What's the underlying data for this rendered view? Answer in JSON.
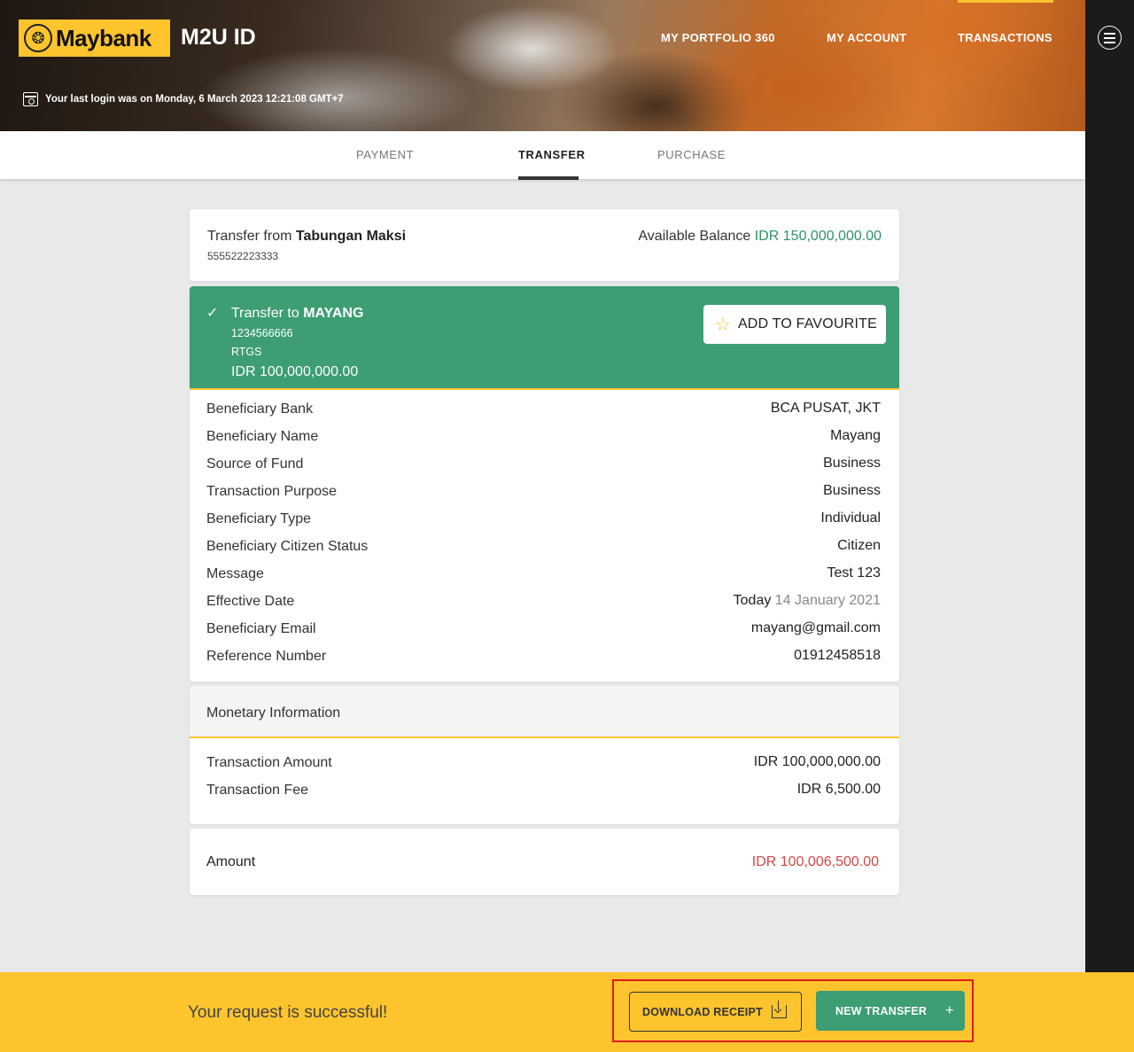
{
  "header": {
    "brand": "Maybank",
    "app_name": "M2U ID",
    "nav": [
      "MY PORTFOLIO 360",
      "MY ACCOUNT",
      "TRANSACTIONS"
    ],
    "last_login": "Your last login was on Monday, 6 March 2023 12:21:08 GMT+7"
  },
  "tabs": [
    "PAYMENT",
    "TRANSFER",
    "PURCHASE"
  ],
  "active_tab": "TRANSFER",
  "transfer_from": {
    "prefix": "Transfer from",
    "account_name": "Tabungan Maksi",
    "account_number": "555522223333",
    "balance_label": "Available Balance",
    "balance_value": "IDR 150,000,000.00"
  },
  "transfer_to": {
    "prefix": "Transfer to",
    "name": "MAYANG",
    "account_number": "1234566666",
    "method": "RTGS",
    "amount": "IDR 100,000,000.00",
    "favourite_label": "ADD TO FAVOURITE"
  },
  "details": [
    {
      "label": "Beneficiary Bank",
      "value": "BCA PUSAT, JKT"
    },
    {
      "label": "Beneficiary Name",
      "value": "Mayang"
    },
    {
      "label": "Source of Fund",
      "value": "Business"
    },
    {
      "label": "Transaction Purpose",
      "value": "Business"
    },
    {
      "label": "Beneficiary Type",
      "value": "Individual"
    },
    {
      "label": "Beneficiary Citizen Status",
      "value": "Citizen"
    },
    {
      "label": "Message",
      "value": "Test 123"
    },
    {
      "label": "Effective Date",
      "value": "Today",
      "value_extra": "14 January 2021"
    },
    {
      "label": "Beneficiary Email",
      "value": "mayang@gmail.com"
    },
    {
      "label": "Reference Number",
      "value": "01912458518"
    }
  ],
  "monetary": {
    "title": "Monetary Information",
    "rows": [
      {
        "label": "Transaction Amount",
        "value": "IDR 100,000,000.00"
      },
      {
        "label": "Transaction Fee",
        "value": "IDR 6,500.00"
      }
    ]
  },
  "total": {
    "label": "Amount",
    "value": "IDR 100,006,500.00"
  },
  "footer": {
    "message": "Your request is successful!",
    "download_label": "DOWNLOAD RECEIPT",
    "new_transfer_label": "NEW TRANSFER"
  },
  "colors": {
    "brand_yellow": "#fec42d",
    "success_green": "#3d9d73",
    "balance_green": "#2e9468",
    "amount_red": "#d64545",
    "highlight_red": "#e21a1a"
  }
}
